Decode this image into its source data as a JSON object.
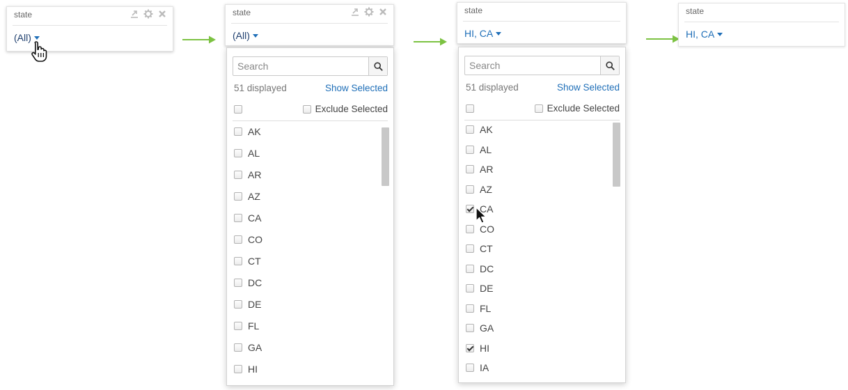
{
  "arrow_color": "#7cc242",
  "link_color": "#1f6fb8",
  "tool_icons": [
    "export-icon",
    "gear-icon",
    "close-icon"
  ],
  "panels": [
    {
      "title": "state",
      "value": "(All)",
      "value_color": "#1f3f6e"
    },
    {
      "title": "state",
      "value": "(All)",
      "value_color": "#1f3f6e",
      "dropdown": {
        "search_placeholder": "Search",
        "count_label": "51 displayed",
        "show_selected": "Show Selected",
        "exclude_selected": "Exclude Selected",
        "items": [
          {
            "label": "AK",
            "checked": false
          },
          {
            "label": "AL",
            "checked": false
          },
          {
            "label": "AR",
            "checked": false
          },
          {
            "label": "AZ",
            "checked": false
          },
          {
            "label": "CA",
            "checked": false
          },
          {
            "label": "CO",
            "checked": false
          },
          {
            "label": "CT",
            "checked": false
          },
          {
            "label": "DC",
            "checked": false
          },
          {
            "label": "DE",
            "checked": false
          },
          {
            "label": "FL",
            "checked": false
          },
          {
            "label": "GA",
            "checked": false
          },
          {
            "label": "HI",
            "checked": false
          }
        ]
      }
    },
    {
      "title": "state",
      "value": "HI, CA",
      "value_color": "#1f6fb8",
      "dropdown": {
        "search_placeholder": "Search",
        "count_label": "51 displayed",
        "show_selected": "Show Selected",
        "exclude_selected": "Exclude Selected",
        "items": [
          {
            "label": "AK",
            "checked": false
          },
          {
            "label": "AL",
            "checked": false
          },
          {
            "label": "AR",
            "checked": false
          },
          {
            "label": "AZ",
            "checked": false
          },
          {
            "label": "CA",
            "checked": true
          },
          {
            "label": "CO",
            "checked": false
          },
          {
            "label": "CT",
            "checked": false
          },
          {
            "label": "DC",
            "checked": false
          },
          {
            "label": "DE",
            "checked": false
          },
          {
            "label": "FL",
            "checked": false
          },
          {
            "label": "GA",
            "checked": false
          },
          {
            "label": "HI",
            "checked": true
          },
          {
            "label": "IA",
            "checked": false
          }
        ]
      }
    },
    {
      "title": "state",
      "value": "HI, CA",
      "value_color": "#1f6fb8"
    }
  ]
}
